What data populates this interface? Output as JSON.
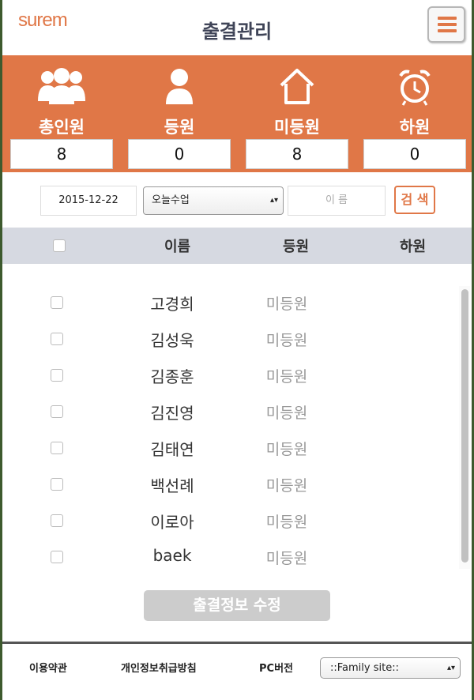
{
  "header": {
    "logo": "surem",
    "title": "출결관리",
    "menu_icon": "hamburger-icon"
  },
  "stats": [
    {
      "label": "총인원",
      "value": "8",
      "icon": "people-group-icon"
    },
    {
      "label": "등원",
      "value": "0",
      "icon": "person-icon"
    },
    {
      "label": "미등원",
      "value": "8",
      "icon": "house-icon"
    },
    {
      "label": "하원",
      "value": "0",
      "icon": "alarm-clock-icon"
    }
  ],
  "search": {
    "date": "2015-12-22",
    "class_select": "오늘수업",
    "name_placeholder": "이 름",
    "button": "검 색"
  },
  "table": {
    "headers": {
      "name": "이름",
      "arrive": "등원",
      "leave": "하원"
    },
    "rows": [
      {
        "name": "고경희",
        "status": "미등원"
      },
      {
        "name": "김성욱",
        "status": "미등원"
      },
      {
        "name": "김종훈",
        "status": "미등원"
      },
      {
        "name": "김진영",
        "status": "미등원"
      },
      {
        "name": "김태연",
        "status": "미등원"
      },
      {
        "name": "백선례",
        "status": "미등원"
      },
      {
        "name": "이로아",
        "status": "미등원"
      },
      {
        "name": "baek",
        "status": "미등원"
      }
    ]
  },
  "edit_button": "출결정보 수정",
  "footer": {
    "terms": "이용약관",
    "privacy": "개인정보취급방침",
    "pc_version": "PC버전",
    "family_site": "::Family site::"
  },
  "colors": {
    "accent": "#e07747",
    "title": "#3f4457",
    "header_bg": "#d6d9e1"
  }
}
